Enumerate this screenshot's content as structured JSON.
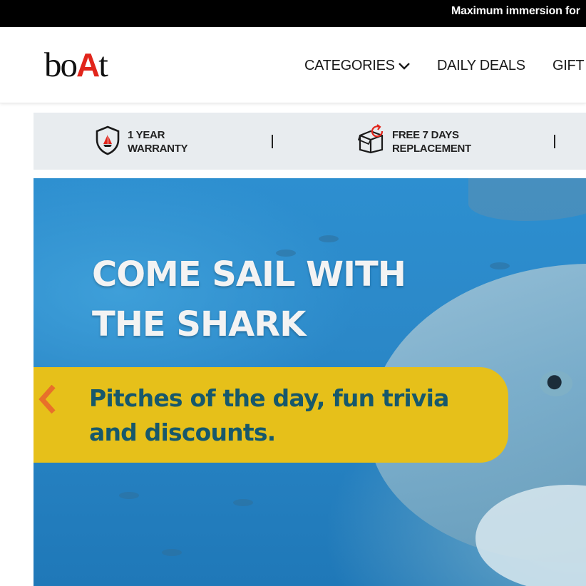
{
  "announcement": {
    "text": "Maximum immersion for"
  },
  "header": {
    "logo": {
      "text_pre": "bo",
      "text_accent": "A",
      "text_post": "t"
    },
    "nav": [
      {
        "label": "CATEGORIES"
      },
      {
        "label": "DAILY DEALS"
      },
      {
        "label": "GIFT"
      }
    ]
  },
  "trust_strip": {
    "items": [
      {
        "icon": "shield-boat-icon",
        "line1": "1 YEAR",
        "line2": "WARRANTY"
      },
      {
        "icon": "box-return-icon",
        "line1": "FREE 7 DAYS",
        "line2": "REPLACEMENT"
      }
    ]
  },
  "hero": {
    "title_line1": "COME SAIL WITH",
    "title_line2": "THE SHARK",
    "subtitle_line1": "Pitches of the day, fun trivia",
    "subtitle_line2": "and discounts."
  },
  "colors": {
    "brand_red": "#e1251b",
    "hero_yellow": "#e6c01a",
    "hero_text": "#17586b",
    "prev_arrow": "#e8702a"
  }
}
